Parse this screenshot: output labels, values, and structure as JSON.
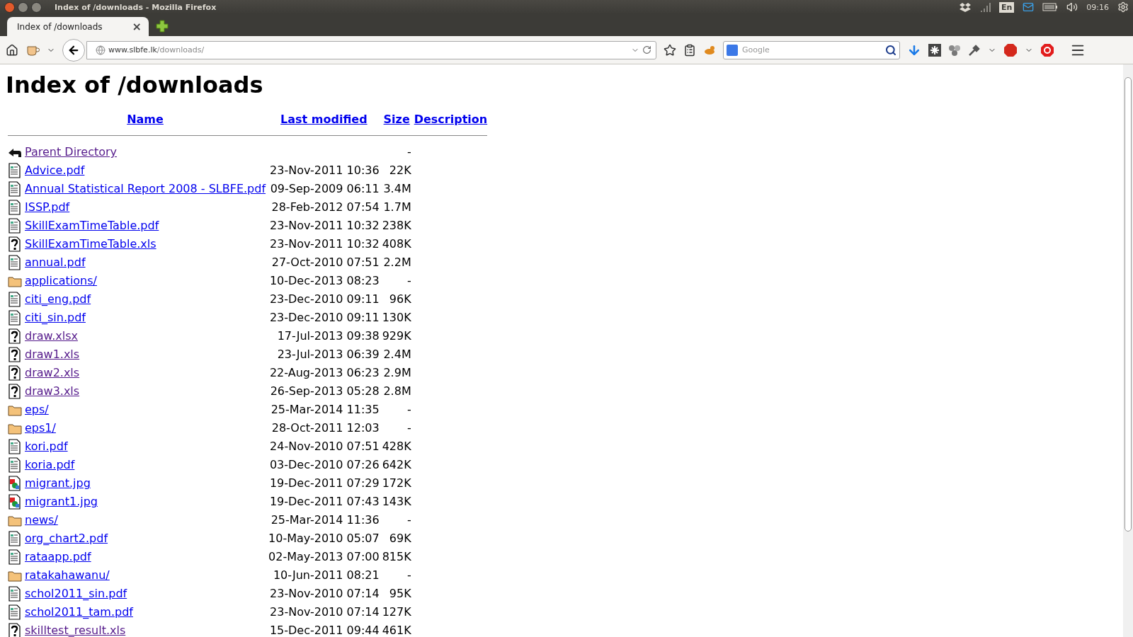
{
  "window": {
    "title": "Index of /downloads - Mozilla Firefox"
  },
  "tray": {
    "keyboard": "En",
    "clock": "09:16"
  },
  "tab": {
    "title": "Index of /downloads",
    "close": "×"
  },
  "toolbar": {
    "url_host": "www.slbfe.lk",
    "url_path": "/downloads/",
    "search_placeholder": "Google"
  },
  "page": {
    "heading": "Index of /downloads",
    "columns": [
      {
        "label": "Name"
      },
      {
        "label": "Last modified"
      },
      {
        "label": "Size"
      },
      {
        "label": "Description"
      }
    ],
    "rows": [
      {
        "kind": "back",
        "name": "Parent Directory",
        "size": "-",
        "visited": true
      },
      {
        "kind": "text",
        "name": "Advice.pdf",
        "modified": "23-Nov-2011 10:36",
        "size": "22K",
        "visited": false
      },
      {
        "kind": "text",
        "name": "Annual Statistical Report 2008 - SLBFE.pdf",
        "modified": "09-Sep-2009 06:11",
        "size": "3.4M",
        "visited": false
      },
      {
        "kind": "text",
        "name": "ISSP.pdf",
        "modified": "28-Feb-2012 07:54",
        "size": "1.7M",
        "visited": false
      },
      {
        "kind": "text",
        "name": "SkillExamTimeTable.pdf",
        "modified": "23-Nov-2011 10:32",
        "size": "238K",
        "visited": false
      },
      {
        "kind": "unknown",
        "name": "SkillExamTimeTable.xls",
        "modified": "23-Nov-2011 10:32",
        "size": "408K",
        "visited": false
      },
      {
        "kind": "text",
        "name": "annual.pdf",
        "modified": "27-Oct-2010 07:51",
        "size": "2.2M",
        "visited": false
      },
      {
        "kind": "folder",
        "name": "applications/",
        "modified": "10-Dec-2013 08:23",
        "size": "-",
        "visited": false
      },
      {
        "kind": "text",
        "name": "citi_eng.pdf",
        "modified": "23-Dec-2010 09:11",
        "size": "96K",
        "visited": false
      },
      {
        "kind": "text",
        "name": "citi_sin.pdf",
        "modified": "23-Dec-2010 09:11",
        "size": "130K",
        "visited": false
      },
      {
        "kind": "unknown",
        "name": "draw.xlsx",
        "modified": "17-Jul-2013 09:38",
        "size": "929K",
        "visited": true
      },
      {
        "kind": "unknown",
        "name": "draw1.xls",
        "modified": "23-Jul-2013 06:39",
        "size": "2.4M",
        "visited": true
      },
      {
        "kind": "unknown",
        "name": "draw2.xls",
        "modified": "22-Aug-2013 06:23",
        "size": "2.9M",
        "visited": true
      },
      {
        "kind": "unknown",
        "name": "draw3.xls",
        "modified": "26-Sep-2013 05:28",
        "size": "2.8M",
        "visited": true
      },
      {
        "kind": "folder",
        "name": "eps/",
        "modified": "25-Mar-2014 11:35",
        "size": "-",
        "visited": false
      },
      {
        "kind": "folder",
        "name": "eps1/",
        "modified": "28-Oct-2011 12:03",
        "size": "-",
        "visited": false
      },
      {
        "kind": "text",
        "name": "kori.pdf",
        "modified": "24-Nov-2010 07:51",
        "size": "428K",
        "visited": false
      },
      {
        "kind": "text",
        "name": "koria.pdf",
        "modified": "03-Dec-2010 07:26",
        "size": "642K",
        "visited": false
      },
      {
        "kind": "image",
        "name": "migrant.jpg",
        "modified": "19-Dec-2011 07:29",
        "size": "172K",
        "visited": false
      },
      {
        "kind": "image",
        "name": "migrant1.jpg",
        "modified": "19-Dec-2011 07:43",
        "size": "143K",
        "visited": false
      },
      {
        "kind": "folder",
        "name": "news/",
        "modified": "25-Mar-2014 11:36",
        "size": "-",
        "visited": false
      },
      {
        "kind": "text",
        "name": "org_chart2.pdf",
        "modified": "10-May-2010 05:07",
        "size": "69K",
        "visited": false
      },
      {
        "kind": "text",
        "name": "rataapp.pdf",
        "modified": "02-May-2013 07:00",
        "size": "815K",
        "visited": false
      },
      {
        "kind": "folder",
        "name": "ratakahawanu/",
        "modified": "10-Jun-2011 08:21",
        "size": "-",
        "visited": false
      },
      {
        "kind": "text",
        "name": "schol2011_sin.pdf",
        "modified": "23-Nov-2010 07:14",
        "size": "95K",
        "visited": false
      },
      {
        "kind": "text",
        "name": "schol2011_tam.pdf",
        "modified": "23-Nov-2010 07:14",
        "size": "127K",
        "visited": false
      },
      {
        "kind": "unknown",
        "name": "skilltest_result.xls",
        "modified": "15-Dec-2011 09:44",
        "size": "461K",
        "visited": true
      }
    ]
  }
}
